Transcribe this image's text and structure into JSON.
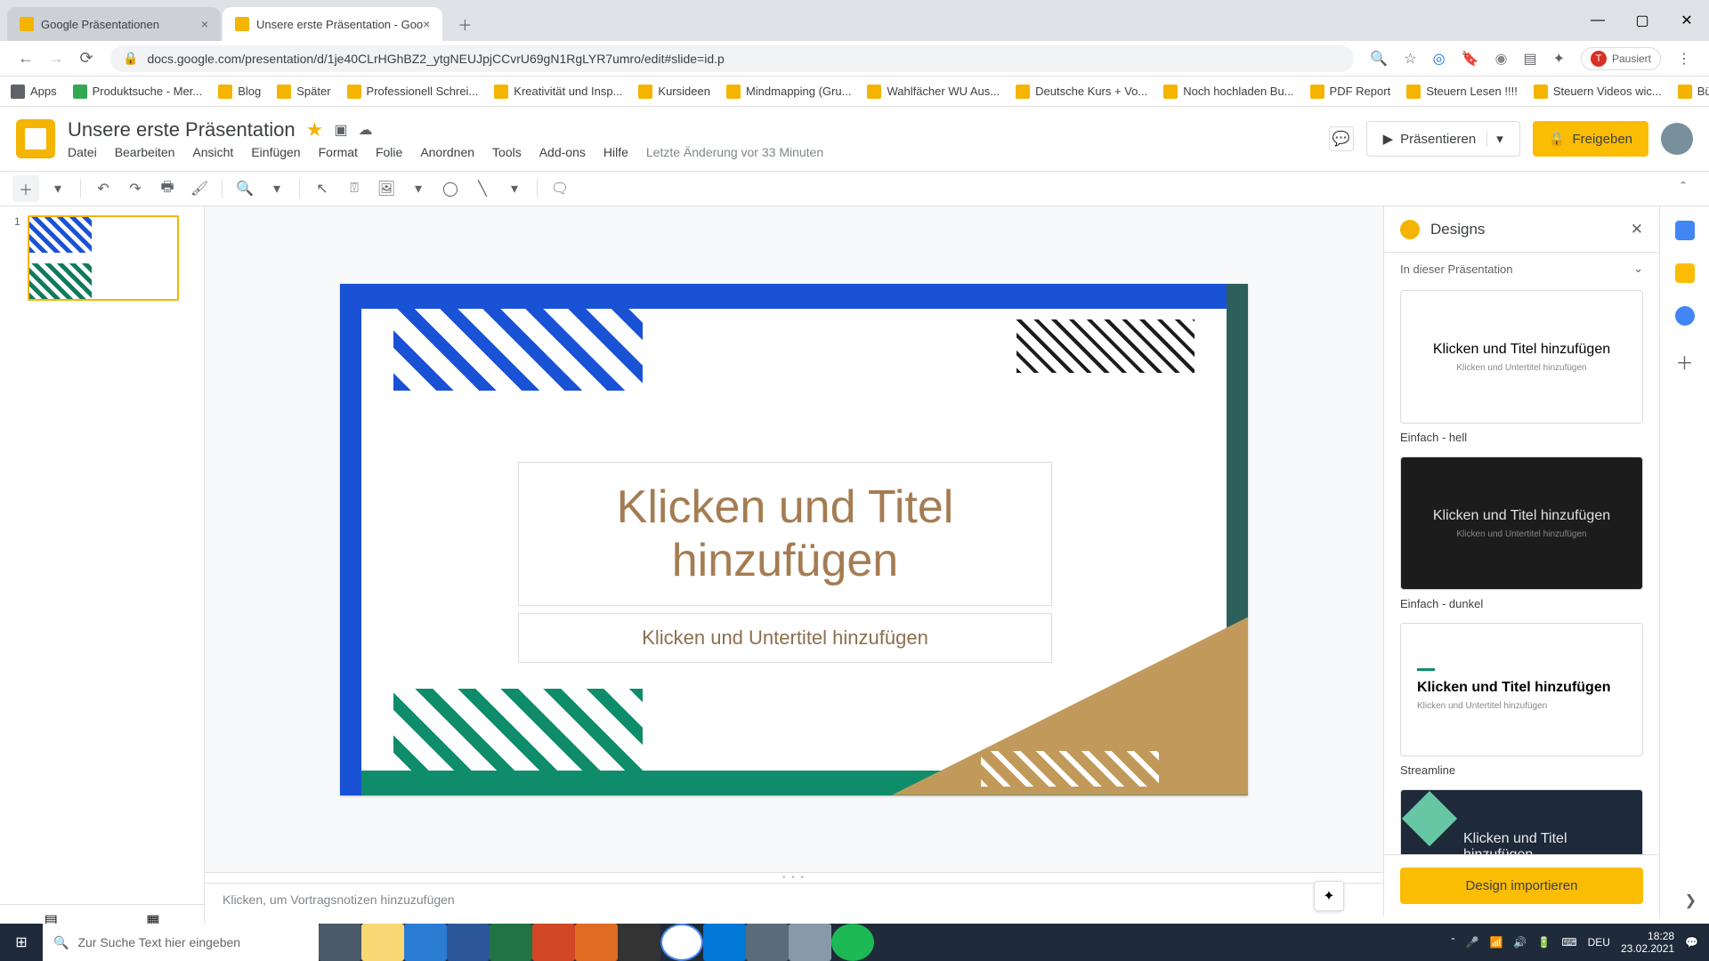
{
  "browser": {
    "tabs": [
      {
        "title": "Google Präsentationen"
      },
      {
        "title": "Unsere erste Präsentation - Goo"
      }
    ],
    "url": "docs.google.com/presentation/d/1je40CLrHGhBZ2_ytgNEUJpjCCvrU69gN1RgLYR7umro/edit#slide=id.p",
    "pause_label": "Pausiert",
    "bookmarks": [
      "Apps",
      "Produktsuche - Mer...",
      "Blog",
      "Später",
      "Professionell Schrei...",
      "Kreativität und Insp...",
      "Kursideen",
      "Mindmapping (Gru...",
      "Wahlfächer WU Aus...",
      "Deutsche Kurs + Vo...",
      "Noch hochladen Bu...",
      "PDF Report",
      "Steuern Lesen !!!!",
      "Steuern Videos wic...",
      "Büro"
    ]
  },
  "app": {
    "doc_title": "Unsere erste Präsentation",
    "menus": [
      "Datei",
      "Bearbeiten",
      "Ansicht",
      "Einfügen",
      "Format",
      "Folie",
      "Anordnen",
      "Tools",
      "Add-ons",
      "Hilfe"
    ],
    "last_edit": "Letzte Änderung vor 33 Minuten",
    "present": "Präsentieren",
    "share": "Freigeben"
  },
  "slide": {
    "number": "1",
    "title_placeholder": "Klicken und Titel hinzufügen",
    "subtitle_placeholder": "Klicken und Untertitel hinzufügen",
    "notes_placeholder": "Klicken, um Vortragsnotizen hinzuzufügen"
  },
  "designs": {
    "panel_title": "Designs",
    "section": "In dieser Präsentation",
    "cards": [
      {
        "title": "Klicken und Titel hinzufügen",
        "sub": "Klicken und Untertitel hinzufügen",
        "label": "Einfach - hell"
      },
      {
        "title": "Klicken und Titel hinzufügen",
        "sub": "Klicken und Untertitel hinzufügen",
        "label": "Einfach - dunkel"
      },
      {
        "title": "Klicken und Titel hinzufügen",
        "sub": "Klicken und Untertitel hinzufügen",
        "label": "Streamline"
      },
      {
        "title": "Klicken und Titel hinzufügen",
        "sub": "",
        "label": ""
      }
    ],
    "import": "Design importieren"
  },
  "taskbar": {
    "search_placeholder": "Zur Suche Text hier eingeben",
    "lang": "DEU",
    "time": "18:28",
    "date": "23.02.2021"
  }
}
